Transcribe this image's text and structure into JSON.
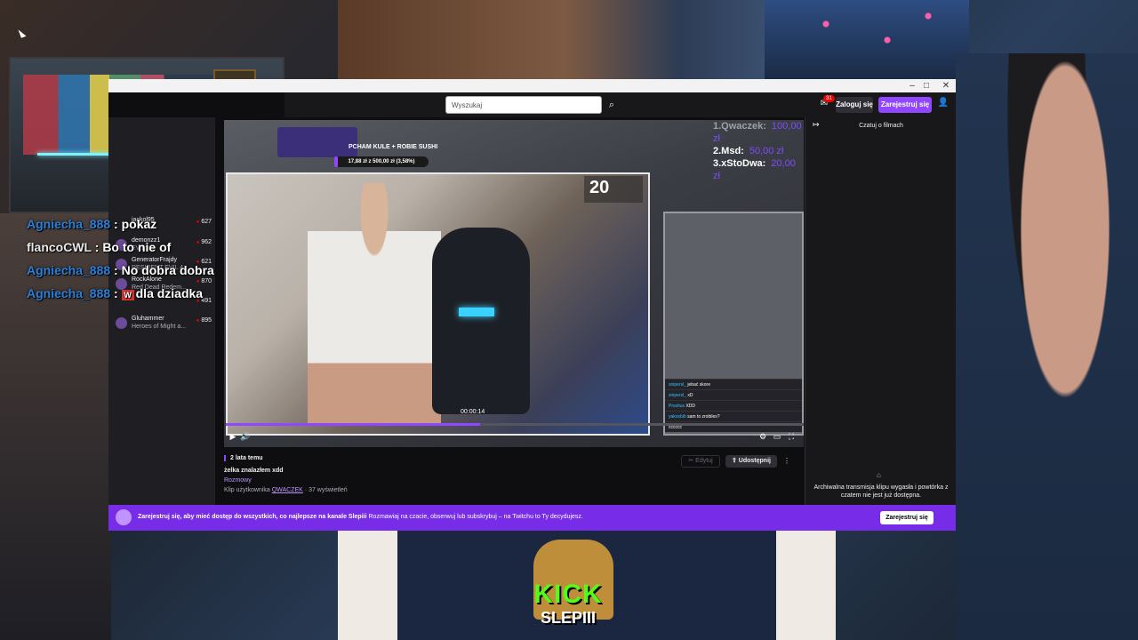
{
  "browser": {
    "window_controls": {
      "minimize": "–",
      "maximize": "□",
      "close": "✕"
    }
  },
  "navbar": {
    "search_placeholder": "Wyszukaj",
    "search_icon": "⌕",
    "notifications_icon": "✉",
    "notifications_count": "31",
    "login_label": "Zaloguj się",
    "signup_label": "Zarejestruj się",
    "user_icon": "👤"
  },
  "sidebar": {
    "items": [
      {
        "name": "jackol95",
        "game": "",
        "viewers": "627"
      },
      {
        "name": "demonzz1",
        "game": "EVIL: r...",
        "viewers": "962"
      },
      {
        "name": "GeneratorFrajdy",
        "game": "RESIDENT EVIL 4",
        "viewers": "621"
      },
      {
        "name": "RockAlone",
        "game": "Red Dead Redem...",
        "viewers": "870"
      },
      {
        "name": "",
        "game": "",
        "viewers": "491"
      },
      {
        "name": "Gluhammer",
        "game": "Heroes of Might a...",
        "viewers": "895"
      }
    ]
  },
  "stream_overlay": {
    "goal_title": "PCHAM KULE + ROBIE SUSHI",
    "goal_progress": "17,88 zł z 500,00 zł (3,58%)",
    "goal_fraction": 0.0358,
    "leaderboard": [
      {
        "rank": "1.Qwaczek:",
        "amount": "100,00 zł"
      },
      {
        "rank": "2.Msd:",
        "amount": "50,00 zł"
      },
      {
        "rank": "3.xStoDwa:",
        "amount": "20,00 zł"
      }
    ],
    "counter": "20",
    "side_chat": [
      {
        "user": "snipersl_",
        "msg": "jebać skore"
      },
      {
        "user": "snipersl_",
        "msg": "xD"
      },
      {
        "user": "Prezitus",
        "msg": "XDD"
      },
      {
        "user": "yakosbib",
        "msg": "sam to zrobiles?"
      },
      {
        "user": "",
        "msg": "cccccc"
      }
    ]
  },
  "player": {
    "time": "00:00:14",
    "progress_fraction": 0.44,
    "icons": {
      "play": "▶",
      "volume": "🔊",
      "settings": "⚙",
      "theatre": "▭",
      "fullscreen": "⛶"
    }
  },
  "clip": {
    "age": "2 lata temu",
    "title": "żelka znalazłem xdd",
    "category": "Rozmowy",
    "author_prefix": "Klip użytkownika",
    "author": "QWACZEK",
    "views": " · 37 wyświetleń",
    "edit_label": "✂ Edytuj",
    "share_label": "⇧ Udostępnij",
    "more_label": "⋮"
  },
  "chat": {
    "collapse_icon": "↦",
    "title": "Czatuj o filmach",
    "archived_icon": "⌂",
    "archived_text": "Archiwalna transmisja klipu wygasła i powtórka z czatem nie jest już dostępna."
  },
  "promo": {
    "text_bold": "Zarejestruj się, aby mieć dostęp do wszystkich, co najlepsze na kanale Slepiii",
    "text": "Rozmawiaj na czacie, obserwuj lub subskrybuj – na Twitchu to Ty decydujesz.",
    "button": "Zarejestruj się"
  },
  "overlay_chat": [
    {
      "user": "Agniecha_888",
      "sep": " : ",
      "msg": "pokaz",
      "badge": ""
    },
    {
      "user": "flancoCWL",
      "sep": " : ",
      "msg": "Bo to nie of",
      "badge": ""
    },
    {
      "user": "Agniecha_888",
      "sep": " : ",
      "msg": "No dobra dobra",
      "badge": ""
    },
    {
      "user": "Agniecha_888",
      "sep": " : ",
      "msg": "dla dziadka",
      "badge": "W"
    }
  ],
  "kick": {
    "word": "KICK",
    "name": "SLEPIII"
  }
}
